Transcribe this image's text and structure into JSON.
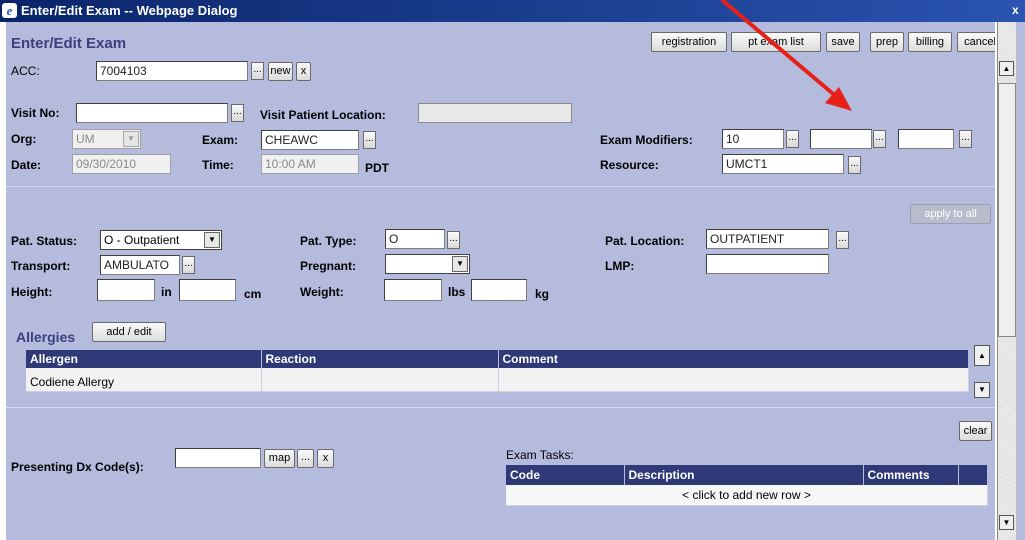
{
  "window": {
    "title": "Enter/Edit Exam -- Webpage Dialog",
    "ie_glyph": "e",
    "close": "x"
  },
  "header": {
    "title": "Enter/Edit Exam"
  },
  "toolbar": {
    "registration": "registration",
    "pt_exam_list": "pt exam list",
    "save": "save",
    "prep": "prep",
    "billing": "billing",
    "cancel": "cancel"
  },
  "acc": {
    "label": "ACC:",
    "value": "7004103",
    "new": "new",
    "x": "x"
  },
  "visit": {
    "visit_no_label": "Visit No:",
    "visit_no_value": "",
    "patient_location_label": "Visit Patient Location:",
    "patient_location_value": ""
  },
  "exam": {
    "org_label": "Org:",
    "org_value": "UM",
    "exam_label": "Exam:",
    "exam_value": "CHEAWC",
    "date_label": "Date:",
    "date_value": "09/30/2010",
    "time_label": "Time:",
    "time_value": "10:00 AM",
    "tz": "PDT",
    "modifiers_label": "Exam Modifiers:",
    "modifier1": "10",
    "modifier2": "",
    "modifier3": "",
    "resource_label": "Resource:",
    "resource_value": "UMCT1"
  },
  "apply_all": "apply to all",
  "patient": {
    "status_label": "Pat. Status:",
    "status_value": "O - Outpatient",
    "type_label": "Pat. Type:",
    "type_value": "O",
    "location_label": "Pat. Location:",
    "location_value": "OUTPATIENT",
    "transport_label": "Transport:",
    "transport_value": "AMBULATO",
    "pregnant_label": "Pregnant:",
    "pregnant_value": "",
    "lmp_label": "LMP:",
    "lmp_value": "",
    "height_label": "Height:",
    "in_label": "in",
    "cm_label": "cm",
    "weight_label": "Weight:",
    "lbs_label": "lbs",
    "kg_label": "kg"
  },
  "allergies": {
    "title": "Allergies",
    "add_edit": "add / edit",
    "columns": [
      "Allergen",
      "Reaction",
      "Comment"
    ],
    "rows": [
      {
        "allergen": "Codiene Allergy",
        "reaction": "",
        "comment": ""
      }
    ]
  },
  "clear": "clear",
  "dx": {
    "label": "Presenting Dx Code(s):",
    "value": "",
    "map": "map",
    "dots": "...",
    "x": "x"
  },
  "tasks": {
    "title": "Exam Tasks:",
    "columns": [
      "Code",
      "Description",
      "Comments"
    ],
    "add_row": "< click to add new row >"
  },
  "colors": {
    "dialog_bg": "#b4bbdd",
    "header_text": "#3b3f7e",
    "table_header": "#2f3977",
    "annotation_arrow": "#e8201a"
  }
}
